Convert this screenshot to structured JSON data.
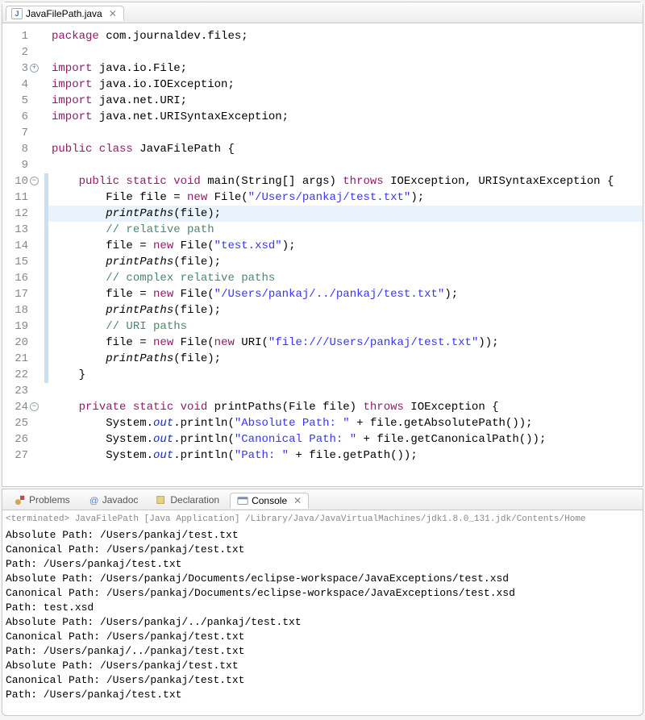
{
  "editor": {
    "tab": {
      "filename": "JavaFilePath.java"
    },
    "lines": [
      {
        "n": 1,
        "fold": "",
        "mod": false,
        "hl": false,
        "tokens": [
          [
            "kw",
            "package"
          ],
          [
            "",
            " com.journaldev.files;"
          ]
        ]
      },
      {
        "n": 2,
        "fold": "",
        "mod": false,
        "hl": false,
        "tokens": [
          [
            "",
            ""
          ]
        ]
      },
      {
        "n": 3,
        "fold": "+",
        "mod": false,
        "hl": false,
        "tokens": [
          [
            "kw",
            "import"
          ],
          [
            "",
            " java.io.File;"
          ]
        ]
      },
      {
        "n": 4,
        "fold": "",
        "mod": false,
        "hl": false,
        "tokens": [
          [
            "kw",
            "import"
          ],
          [
            "",
            " java.io.IOException;"
          ]
        ]
      },
      {
        "n": 5,
        "fold": "",
        "mod": false,
        "hl": false,
        "tokens": [
          [
            "kw",
            "import"
          ],
          [
            "",
            " java.net.URI;"
          ]
        ]
      },
      {
        "n": 6,
        "fold": "",
        "mod": false,
        "hl": false,
        "tokens": [
          [
            "kw",
            "import"
          ],
          [
            "",
            " java.net.URISyntaxException;"
          ]
        ]
      },
      {
        "n": 7,
        "fold": "",
        "mod": false,
        "hl": false,
        "tokens": [
          [
            "",
            ""
          ]
        ]
      },
      {
        "n": 8,
        "fold": "",
        "mod": false,
        "hl": false,
        "tokens": [
          [
            "kw",
            "public class"
          ],
          [
            "",
            " JavaFilePath {"
          ]
        ]
      },
      {
        "n": 9,
        "fold": "",
        "mod": false,
        "hl": false,
        "tokens": [
          [
            "",
            ""
          ]
        ]
      },
      {
        "n": 10,
        "fold": "-",
        "mod": true,
        "hl": false,
        "tokens": [
          [
            "",
            "    "
          ],
          [
            "kw",
            "public static void"
          ],
          [
            "",
            " main(String[] args) "
          ],
          [
            "kw",
            "throws"
          ],
          [
            "",
            " IOException, URISyntaxException {"
          ]
        ]
      },
      {
        "n": 11,
        "fold": "",
        "mod": true,
        "hl": false,
        "tokens": [
          [
            "",
            "        File file = "
          ],
          [
            "kw",
            "new"
          ],
          [
            "",
            " File("
          ],
          [
            "str",
            "\"/Users/pankaj/test.txt\""
          ],
          [
            "",
            ");"
          ]
        ]
      },
      {
        "n": 12,
        "fold": "",
        "mod": true,
        "hl": true,
        "tokens": [
          [
            "",
            "        "
          ],
          [
            "it",
            "printPaths"
          ],
          [
            "",
            "(file);"
          ]
        ]
      },
      {
        "n": 13,
        "fold": "",
        "mod": true,
        "hl": false,
        "tokens": [
          [
            "",
            "        "
          ],
          [
            "cmt",
            "// relative path"
          ]
        ]
      },
      {
        "n": 14,
        "fold": "",
        "mod": true,
        "hl": false,
        "tokens": [
          [
            "",
            "        file = "
          ],
          [
            "kw",
            "new"
          ],
          [
            "",
            " File("
          ],
          [
            "str",
            "\"test.xsd\""
          ],
          [
            "",
            ");"
          ]
        ]
      },
      {
        "n": 15,
        "fold": "",
        "mod": true,
        "hl": false,
        "tokens": [
          [
            "",
            "        "
          ],
          [
            "it",
            "printPaths"
          ],
          [
            "",
            "(file);"
          ]
        ]
      },
      {
        "n": 16,
        "fold": "",
        "mod": true,
        "hl": false,
        "tokens": [
          [
            "",
            "        "
          ],
          [
            "cmt",
            "// complex relative paths"
          ]
        ]
      },
      {
        "n": 17,
        "fold": "",
        "mod": true,
        "hl": false,
        "tokens": [
          [
            "",
            "        file = "
          ],
          [
            "kw",
            "new"
          ],
          [
            "",
            " File("
          ],
          [
            "str",
            "\"/Users/pankaj/../pankaj/test.txt\""
          ],
          [
            "",
            ");"
          ]
        ]
      },
      {
        "n": 18,
        "fold": "",
        "mod": true,
        "hl": false,
        "tokens": [
          [
            "",
            "        "
          ],
          [
            "it",
            "printPaths"
          ],
          [
            "",
            "(file);"
          ]
        ]
      },
      {
        "n": 19,
        "fold": "",
        "mod": true,
        "hl": false,
        "tokens": [
          [
            "",
            "        "
          ],
          [
            "cmt",
            "// URI paths"
          ]
        ]
      },
      {
        "n": 20,
        "fold": "",
        "mod": true,
        "hl": false,
        "tokens": [
          [
            "",
            "        file = "
          ],
          [
            "kw",
            "new"
          ],
          [
            "",
            " File("
          ],
          [
            "kw",
            "new"
          ],
          [
            "",
            " URI("
          ],
          [
            "str",
            "\"file:///Users/pankaj/test.txt\""
          ],
          [
            "",
            "));"
          ]
        ]
      },
      {
        "n": 21,
        "fold": "",
        "mod": true,
        "hl": false,
        "tokens": [
          [
            "",
            "        "
          ],
          [
            "it",
            "printPaths"
          ],
          [
            "",
            "(file);"
          ]
        ]
      },
      {
        "n": 22,
        "fold": "",
        "mod": true,
        "hl": false,
        "tokens": [
          [
            "",
            "    }"
          ]
        ]
      },
      {
        "n": 23,
        "fold": "",
        "mod": false,
        "hl": false,
        "tokens": [
          [
            "",
            ""
          ]
        ]
      },
      {
        "n": 24,
        "fold": "-",
        "mod": false,
        "hl": false,
        "tokens": [
          [
            "",
            "    "
          ],
          [
            "kw",
            "private static void"
          ],
          [
            "",
            " printPaths(File file) "
          ],
          [
            "kw",
            "throws"
          ],
          [
            "",
            " IOException {"
          ]
        ]
      },
      {
        "n": 25,
        "fold": "",
        "mod": false,
        "hl": false,
        "tokens": [
          [
            "",
            "        System."
          ],
          [
            "fld",
            "out"
          ],
          [
            "",
            ".println("
          ],
          [
            "str",
            "\"Absolute Path: \""
          ],
          [
            "",
            " + file.getAbsolutePath());"
          ]
        ]
      },
      {
        "n": 26,
        "fold": "",
        "mod": false,
        "hl": false,
        "tokens": [
          [
            "",
            "        System."
          ],
          [
            "fld",
            "out"
          ],
          [
            "",
            ".println("
          ],
          [
            "str",
            "\"Canonical Path: \""
          ],
          [
            "",
            " + file.getCanonicalPath());"
          ]
        ]
      },
      {
        "n": 27,
        "fold": "",
        "mod": false,
        "hl": false,
        "tokens": [
          [
            "",
            "        System."
          ],
          [
            "fld",
            "out"
          ],
          [
            "",
            ".println("
          ],
          [
            "str",
            "\"Path: \""
          ],
          [
            "",
            " + file.getPath());"
          ]
        ]
      }
    ]
  },
  "views": {
    "items": [
      {
        "label": "Problems",
        "active": false,
        "icon": "problems-icon"
      },
      {
        "label": "Javadoc",
        "active": false,
        "icon": "javadoc-icon"
      },
      {
        "label": "Declaration",
        "active": false,
        "icon": "declaration-icon"
      },
      {
        "label": "Console",
        "active": true,
        "icon": "console-icon"
      }
    ]
  },
  "console": {
    "header": "<terminated> JavaFilePath [Java Application] /Library/Java/JavaVirtualMachines/jdk1.8.0_131.jdk/Contents/Home",
    "lines": [
      "Absolute Path: /Users/pankaj/test.txt",
      "Canonical Path: /Users/pankaj/test.txt",
      "Path: /Users/pankaj/test.txt",
      "Absolute Path: /Users/pankaj/Documents/eclipse-workspace/JavaExceptions/test.xsd",
      "Canonical Path: /Users/pankaj/Documents/eclipse-workspace/JavaExceptions/test.xsd",
      "Path: test.xsd",
      "Absolute Path: /Users/pankaj/../pankaj/test.txt",
      "Canonical Path: /Users/pankaj/test.txt",
      "Path: /Users/pankaj/../pankaj/test.txt",
      "Absolute Path: /Users/pankaj/test.txt",
      "Canonical Path: /Users/pankaj/test.txt",
      "Path: /Users/pankaj/test.txt"
    ]
  }
}
